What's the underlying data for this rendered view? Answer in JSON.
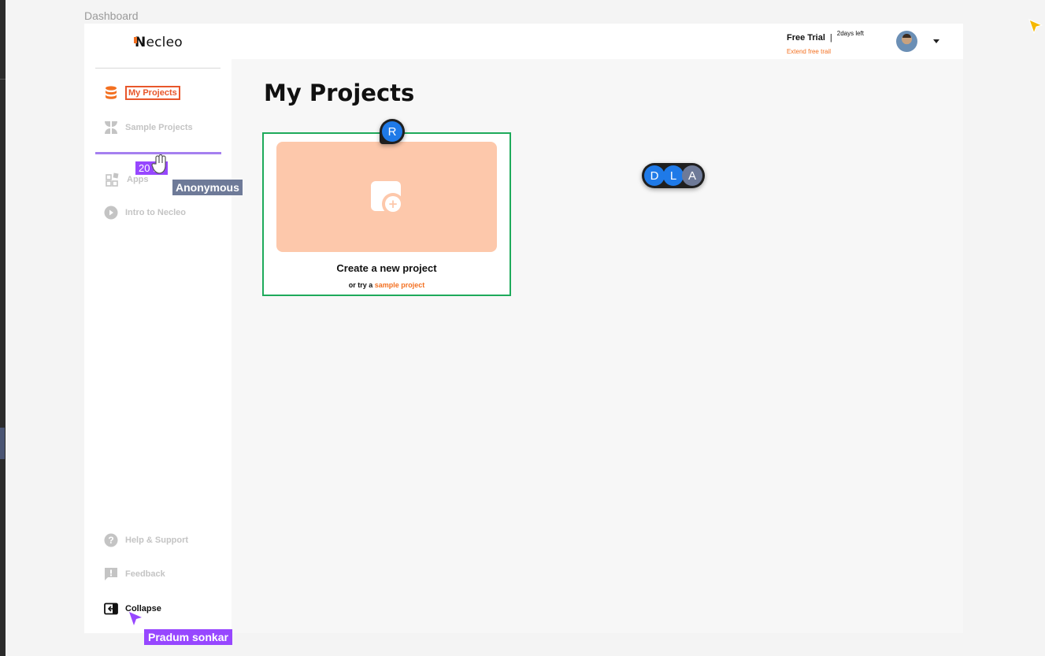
{
  "frame": {
    "label": "Dashboard"
  },
  "brand": {
    "logo_first": "N",
    "logo_rest": "ecleo",
    "accent_color": "#f37021"
  },
  "header": {
    "plan": "Free Trial",
    "separator": "|",
    "days_left": "2days left",
    "extend_link": "Extend free trail"
  },
  "sidebar": {
    "nav": [
      {
        "label": "My Projects",
        "icon": "database-icon",
        "active": true
      },
      {
        "label": "Sample Projects",
        "icon": "grid-icon",
        "active": false
      },
      {
        "label": "Apps",
        "icon": "apps-icon",
        "active": false
      },
      {
        "label": "Intro to Necleo",
        "icon": "play-icon",
        "active": false
      }
    ],
    "bottom": [
      {
        "label": "Help & Support",
        "icon": "help-icon"
      },
      {
        "label": "Feedback",
        "icon": "feedback-icon"
      },
      {
        "label": "Collapse",
        "icon": "collapse-icon"
      }
    ]
  },
  "main": {
    "title": "My Projects",
    "create_card": {
      "title": "Create a new project",
      "sub_prefix": "or try a",
      "sub_link": "sample project"
    }
  },
  "collab": {
    "drag_badge": "20 : 1",
    "anon_tag": "Anonymous",
    "user_tag": "Pradum sonkar",
    "card_presence": "R",
    "group_presence": [
      "D",
      "L",
      "A"
    ]
  },
  "colors": {
    "card_border": "#1eaa5b",
    "card_fill": "#fdc8ab",
    "presence_blue": "#1f7ae8",
    "collab_purple": "#9747ff"
  }
}
